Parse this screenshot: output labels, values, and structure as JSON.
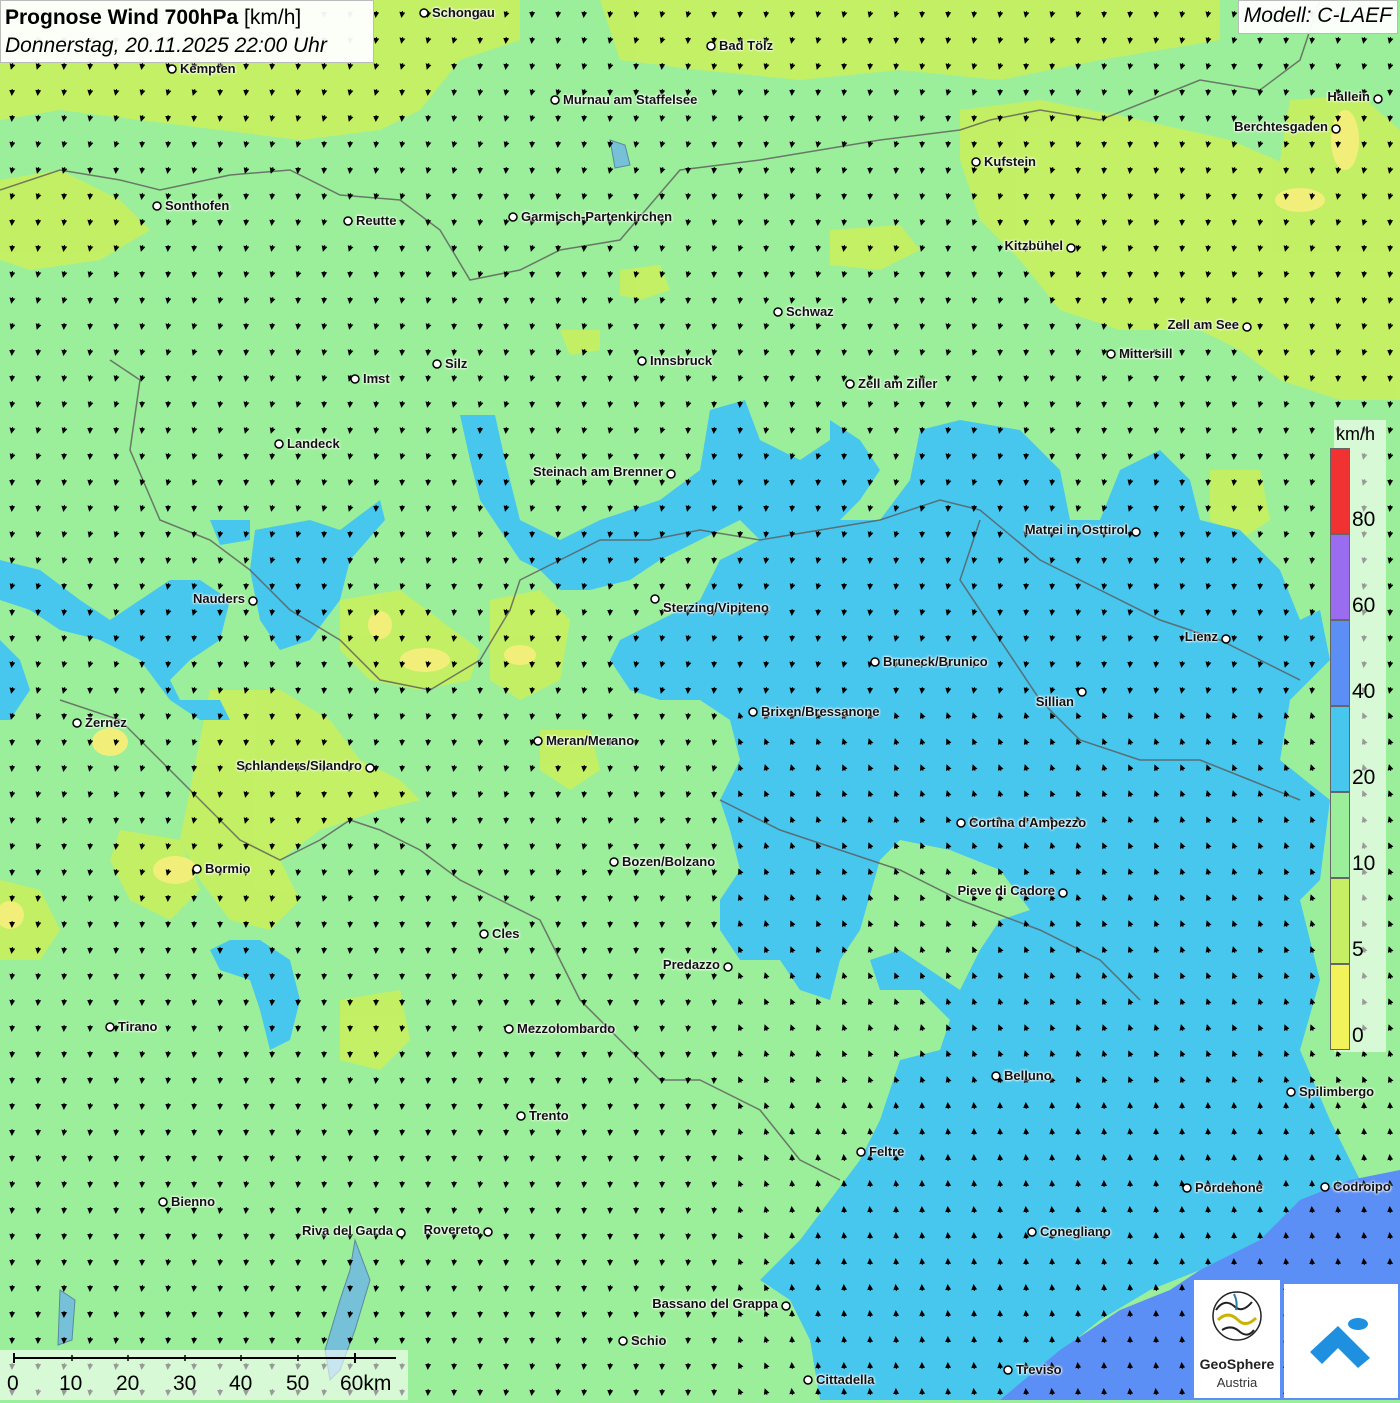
{
  "title": {
    "bold": "Prognose Wind 700hPa",
    "unit": "[km/h]",
    "datetime": "Donnerstag, 20.11.2025 22:00 Uhr"
  },
  "model": "Modell: C-LAEF",
  "colors": {
    "yellow": "#f2ee7a",
    "green": "#9cef9a",
    "cyan": "#47c6ee",
    "blue": "#5b8ff5",
    "purple": "#9a6cf0",
    "red": "#f03232"
  },
  "legend": {
    "unit": "km/h",
    "ticks": [
      "0",
      "5",
      "10",
      "20",
      "40",
      "60",
      "80"
    ],
    "bands": [
      {
        "color": "#f2f25a"
      },
      {
        "color": "#c6ef63"
      },
      {
        "color": "#9cef9a"
      },
      {
        "color": "#47c6ee"
      },
      {
        "color": "#5b8ff5"
      },
      {
        "color": "#9a6cf0"
      },
      {
        "color": "#f03232"
      }
    ]
  },
  "scale": {
    "ticks": [
      "0",
      "10",
      "20",
      "30",
      "40",
      "50",
      "60km"
    ]
  },
  "logos": {
    "geosphere_line1": "GeoSphere",
    "geosphere_line2": "Austria"
  },
  "cities": [
    {
      "name": "Schongau",
      "slug": "schongau"
    },
    {
      "name": "Bad Tölz",
      "slug": "bad-toelz"
    },
    {
      "name": "Kempten",
      "slug": "kempten"
    },
    {
      "name": "Murnau am Staffelsee",
      "slug": "murnau"
    },
    {
      "name": "Hallein",
      "slug": "hallein"
    },
    {
      "name": "Berchtesgaden",
      "slug": "berchtesgaden"
    },
    {
      "name": "Kufstein",
      "slug": "kufstein"
    },
    {
      "name": "Sonthofen",
      "slug": "sonthofen"
    },
    {
      "name": "Reutte",
      "slug": "reutte"
    },
    {
      "name": "Garmisch-Partenkirchen",
      "slug": "garmisch"
    },
    {
      "name": "Kitzbühel",
      "slug": "kitzbuehel"
    },
    {
      "name": "Schwaz",
      "slug": "schwaz"
    },
    {
      "name": "Zell am See",
      "slug": "zell-am-see"
    },
    {
      "name": "Mittersill",
      "slug": "mittersill"
    },
    {
      "name": "Innsbruck",
      "slug": "innsbruck"
    },
    {
      "name": "Silz",
      "slug": "silz"
    },
    {
      "name": "Imst",
      "slug": "imst"
    },
    {
      "name": "Zell am Ziller",
      "slug": "zell-am-ziller"
    },
    {
      "name": "Landeck",
      "slug": "landeck"
    },
    {
      "name": "Steinach am Brenner",
      "slug": "steinach"
    },
    {
      "name": "Matrei in Osttirol",
      "slug": "matrei"
    },
    {
      "name": "Nauders",
      "slug": "nauders"
    },
    {
      "name": "Sterzing/Vipiteno",
      "slug": "sterzing"
    },
    {
      "name": "Lienz",
      "slug": "lienz"
    },
    {
      "name": "Bruneck/Brunico",
      "slug": "bruneck"
    },
    {
      "name": "Sillian",
      "slug": "sillian"
    },
    {
      "name": "Zernez",
      "slug": "zernez"
    },
    {
      "name": "Brixen/Bressanone",
      "slug": "brixen"
    },
    {
      "name": "Meran/Merano",
      "slug": "meran"
    },
    {
      "name": "Schlanders/Silandro",
      "slug": "schlanders"
    },
    {
      "name": "Cortina d'Ampezzo",
      "slug": "cortina"
    },
    {
      "name": "Bozen/Bolzano",
      "slug": "bozen"
    },
    {
      "name": "Bormio",
      "slug": "bormio"
    },
    {
      "name": "Pieve di Cadore",
      "slug": "pieve-di-cadore"
    },
    {
      "name": "Cles",
      "slug": "cles"
    },
    {
      "name": "Predazzo",
      "slug": "predazzo"
    },
    {
      "name": "Tirano",
      "slug": "tirano"
    },
    {
      "name": "Mezzolombardo",
      "slug": "mezzolombardo"
    },
    {
      "name": "Belluno",
      "slug": "belluno"
    },
    {
      "name": "Spilimbergo",
      "slug": "spilimbergo"
    },
    {
      "name": "Trento",
      "slug": "trento"
    },
    {
      "name": "Feltre",
      "slug": "feltre"
    },
    {
      "name": "Pordenone",
      "slug": "pordenone"
    },
    {
      "name": "Codroipo",
      "slug": "codroipo"
    },
    {
      "name": "Bienno",
      "slug": "bienno"
    },
    {
      "name": "Riva del Garda",
      "slug": "riva"
    },
    {
      "name": "Rovereto",
      "slug": "rovereto"
    },
    {
      "name": "Conegliano",
      "slug": "conegliano"
    },
    {
      "name": "Bassano del Grappa",
      "slug": "bassano"
    },
    {
      "name": "Schio",
      "slug": "schio"
    },
    {
      "name": "Treviso",
      "slug": "treviso"
    },
    {
      "name": "Cittadella",
      "slug": "cittadella"
    }
  ]
}
